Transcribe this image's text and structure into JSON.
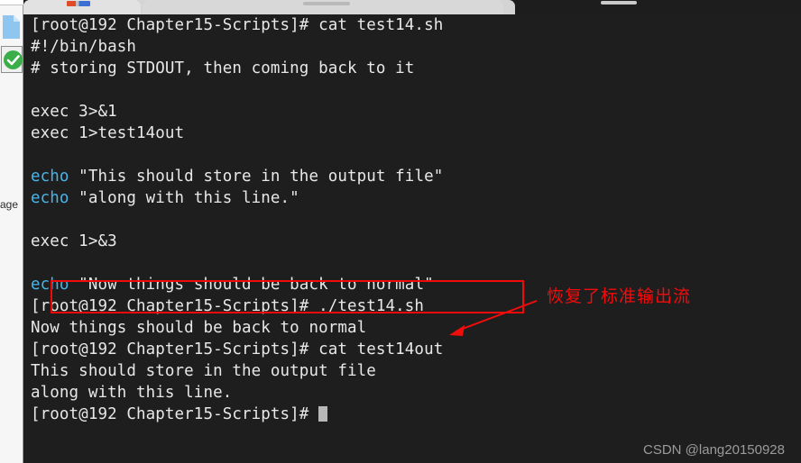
{
  "window": {
    "background_color": "#1e1e1e",
    "text_color": "#e8e8e8",
    "keyword_color": "#49b4e8",
    "annotation_color": "#f30c0c"
  },
  "sidebar": {
    "icons": [
      {
        "name": "document-icon",
        "color": "#8ec6f0"
      },
      {
        "name": "green-check-icon",
        "color": "#3cae49"
      }
    ],
    "clipped_label": "age"
  },
  "tabbar": {
    "tabs": [
      {
        "label": ""
      },
      {
        "label": ""
      }
    ]
  },
  "terminal": {
    "lines": [
      {
        "id": "l1",
        "segments": [
          {
            "text": "[root@192 Chapter15-Scripts]# cat test14.sh",
            "style": "normal"
          }
        ]
      },
      {
        "id": "l2",
        "segments": [
          {
            "text": "#!/bin/bash",
            "style": "normal"
          }
        ]
      },
      {
        "id": "l3",
        "segments": [
          {
            "text": "# storing STDOUT, then coming back to it",
            "style": "normal"
          }
        ]
      },
      {
        "id": "l4",
        "segments": [
          {
            "text": "",
            "style": "normal"
          }
        ]
      },
      {
        "id": "l5",
        "segments": [
          {
            "text": "exec 3>&1",
            "style": "normal"
          }
        ]
      },
      {
        "id": "l6",
        "segments": [
          {
            "text": "exec 1>test14out",
            "style": "normal"
          }
        ]
      },
      {
        "id": "l7",
        "segments": [
          {
            "text": "",
            "style": "normal"
          }
        ]
      },
      {
        "id": "l8",
        "segments": [
          {
            "text": "echo",
            "style": "keyword"
          },
          {
            "text": " \"This should store in the output file\"",
            "style": "normal"
          }
        ]
      },
      {
        "id": "l9",
        "segments": [
          {
            "text": "echo",
            "style": "keyword"
          },
          {
            "text": " \"along with this line.\"",
            "style": "normal"
          }
        ]
      },
      {
        "id": "l10",
        "segments": [
          {
            "text": "",
            "style": "normal"
          }
        ]
      },
      {
        "id": "l11",
        "segments": [
          {
            "text": "exec 1>&3",
            "style": "normal"
          }
        ]
      },
      {
        "id": "l12",
        "segments": [
          {
            "text": "",
            "style": "normal"
          }
        ]
      },
      {
        "id": "l13",
        "segments": [
          {
            "text": "echo",
            "style": "keyword"
          },
          {
            "text": " \"Now things should be back to normal\"",
            "style": "normal"
          }
        ]
      },
      {
        "id": "l14",
        "segments": [
          {
            "text": "[root@192 Chapter15-Scripts]# ./test14.sh",
            "style": "normal"
          }
        ]
      },
      {
        "id": "l15",
        "segments": [
          {
            "text": "Now things should be back to normal",
            "style": "normal"
          }
        ]
      },
      {
        "id": "l16",
        "segments": [
          {
            "text": "[root@192 Chapter15-Scripts]# cat test14out",
            "style": "normal"
          }
        ]
      },
      {
        "id": "l17",
        "segments": [
          {
            "text": "This should store in the output file",
            "style": "normal"
          }
        ]
      },
      {
        "id": "l18",
        "segments": [
          {
            "text": "along with this line.",
            "style": "normal"
          }
        ]
      },
      {
        "id": "l19",
        "segments": [
          {
            "text": "[root@192 Chapter15-Scripts]# ",
            "style": "normal"
          },
          {
            "text": "",
            "style": "cursor"
          }
        ]
      }
    ]
  },
  "annotations": {
    "highlight_box_target": "echo \"Now things should be back to normal\"",
    "callout_text": "恢复了标准输出流"
  },
  "watermark": {
    "text": "CSDN @lang20150928"
  }
}
